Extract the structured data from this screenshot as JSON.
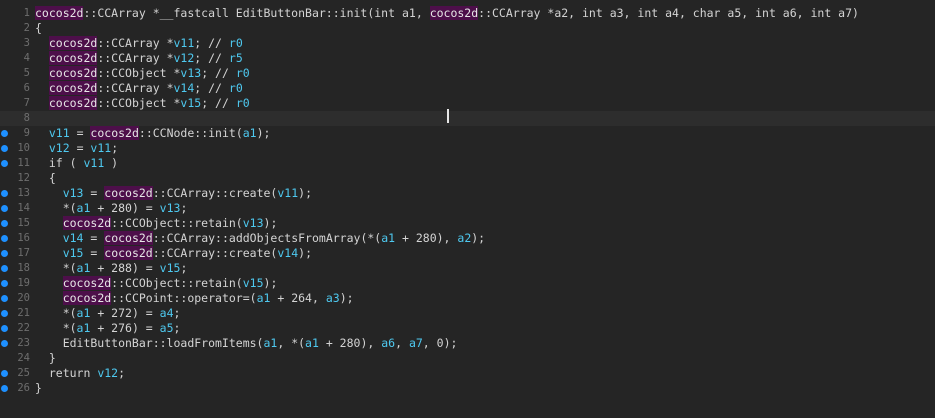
{
  "editor": {
    "lines": [
      {
        "num": "1",
        "dot": false,
        "tokens": [
          {
            "t": "cocos2d",
            "c": "ns"
          },
          {
            "t": "::CCArray *__fastcall EditButtonBar::init(int ",
            "c": "tp"
          },
          {
            "t": "a1",
            "c": "tp"
          },
          {
            "t": ", ",
            "c": "tp"
          },
          {
            "t": "cocos2d",
            "c": "ns"
          },
          {
            "t": "::CCArray *a2, int a3, int a4, char a5, int a6, int a7)",
            "c": "tp"
          }
        ]
      },
      {
        "num": "2",
        "dot": false,
        "tokens": [
          {
            "t": "{",
            "c": "tp"
          }
        ]
      },
      {
        "num": "3",
        "dot": false,
        "tokens": [
          {
            "t": "  ",
            "c": "tp"
          },
          {
            "t": "cocos2d",
            "c": "ns"
          },
          {
            "t": "::CCArray *",
            "c": "tp"
          },
          {
            "t": "v11",
            "c": "var"
          },
          {
            "t": "; // ",
            "c": "cm"
          },
          {
            "t": "r0",
            "c": "var"
          }
        ]
      },
      {
        "num": "4",
        "dot": false,
        "tokens": [
          {
            "t": "  ",
            "c": "tp"
          },
          {
            "t": "cocos2d",
            "c": "ns"
          },
          {
            "t": "::CCArray *",
            "c": "tp"
          },
          {
            "t": "v12",
            "c": "var"
          },
          {
            "t": "; // ",
            "c": "cm"
          },
          {
            "t": "r5",
            "c": "var"
          }
        ]
      },
      {
        "num": "5",
        "dot": false,
        "tokens": [
          {
            "t": "  ",
            "c": "tp"
          },
          {
            "t": "cocos2d",
            "c": "ns"
          },
          {
            "t": "::CCObject *",
            "c": "tp"
          },
          {
            "t": "v13",
            "c": "var"
          },
          {
            "t": "; // ",
            "c": "cm"
          },
          {
            "t": "r0",
            "c": "var"
          }
        ]
      },
      {
        "num": "6",
        "dot": false,
        "tokens": [
          {
            "t": "  ",
            "c": "tp"
          },
          {
            "t": "cocos2d",
            "c": "ns"
          },
          {
            "t": "::CCArray *",
            "c": "tp"
          },
          {
            "t": "v14",
            "c": "var"
          },
          {
            "t": "; // ",
            "c": "cm"
          },
          {
            "t": "r0",
            "c": "var"
          }
        ]
      },
      {
        "num": "7",
        "dot": false,
        "tokens": [
          {
            "t": "  ",
            "c": "tp"
          },
          {
            "t": "cocos2d",
            "c": "ns"
          },
          {
            "t": "::CCObject *",
            "c": "tp"
          },
          {
            "t": "v15",
            "c": "var"
          },
          {
            "t": "; // ",
            "c": "cm"
          },
          {
            "t": "r0",
            "c": "var"
          }
        ]
      },
      {
        "num": "8",
        "dot": false,
        "current": true,
        "tokens": []
      },
      {
        "num": "9",
        "dot": true,
        "tokens": [
          {
            "t": "  ",
            "c": "tp"
          },
          {
            "t": "v11",
            "c": "var"
          },
          {
            "t": " = ",
            "c": "tp"
          },
          {
            "t": "cocos2d",
            "c": "ns"
          },
          {
            "t": "::CCNode::init(",
            "c": "tp"
          },
          {
            "t": "a1",
            "c": "var"
          },
          {
            "t": ");",
            "c": "tp"
          }
        ]
      },
      {
        "num": "10",
        "dot": true,
        "tokens": [
          {
            "t": "  ",
            "c": "tp"
          },
          {
            "t": "v12",
            "c": "var"
          },
          {
            "t": " = ",
            "c": "tp"
          },
          {
            "t": "v11",
            "c": "var"
          },
          {
            "t": ";",
            "c": "tp"
          }
        ]
      },
      {
        "num": "11",
        "dot": true,
        "tokens": [
          {
            "t": "  if ( ",
            "c": "kw"
          },
          {
            "t": "v11",
            "c": "var"
          },
          {
            "t": " )",
            "c": "tp"
          }
        ]
      },
      {
        "num": "12",
        "dot": false,
        "tokens": [
          {
            "t": "  {",
            "c": "tp"
          }
        ]
      },
      {
        "num": "13",
        "dot": true,
        "tokens": [
          {
            "t": "    ",
            "c": "tp"
          },
          {
            "t": "v13",
            "c": "var"
          },
          {
            "t": " = ",
            "c": "tp"
          },
          {
            "t": "cocos2d",
            "c": "ns"
          },
          {
            "t": "::CCArray::create(",
            "c": "tp"
          },
          {
            "t": "v11",
            "c": "var"
          },
          {
            "t": ");",
            "c": "tp"
          }
        ]
      },
      {
        "num": "14",
        "dot": true,
        "tokens": [
          {
            "t": "    *(",
            "c": "tp"
          },
          {
            "t": "a1",
            "c": "var"
          },
          {
            "t": " + 280) = ",
            "c": "tp"
          },
          {
            "t": "v13",
            "c": "var"
          },
          {
            "t": ";",
            "c": "tp"
          }
        ]
      },
      {
        "num": "15",
        "dot": true,
        "tokens": [
          {
            "t": "    ",
            "c": "tp"
          },
          {
            "t": "cocos2d",
            "c": "ns"
          },
          {
            "t": "::CCObject::retain(",
            "c": "tp"
          },
          {
            "t": "v13",
            "c": "var"
          },
          {
            "t": ");",
            "c": "tp"
          }
        ]
      },
      {
        "num": "16",
        "dot": true,
        "tokens": [
          {
            "t": "    ",
            "c": "tp"
          },
          {
            "t": "v14",
            "c": "var"
          },
          {
            "t": " = ",
            "c": "tp"
          },
          {
            "t": "cocos2d",
            "c": "ns"
          },
          {
            "t": "::CCArray::addObjectsFromArray(*(",
            "c": "tp"
          },
          {
            "t": "a1",
            "c": "var"
          },
          {
            "t": " + 280), ",
            "c": "tp"
          },
          {
            "t": "a2",
            "c": "var"
          },
          {
            "t": ");",
            "c": "tp"
          }
        ]
      },
      {
        "num": "17",
        "dot": true,
        "tokens": [
          {
            "t": "    ",
            "c": "tp"
          },
          {
            "t": "v15",
            "c": "var"
          },
          {
            "t": " = ",
            "c": "tp"
          },
          {
            "t": "cocos2d",
            "c": "ns"
          },
          {
            "t": "::CCArray::create(",
            "c": "tp"
          },
          {
            "t": "v14",
            "c": "var"
          },
          {
            "t": ");",
            "c": "tp"
          }
        ]
      },
      {
        "num": "18",
        "dot": true,
        "tokens": [
          {
            "t": "    *(",
            "c": "tp"
          },
          {
            "t": "a1",
            "c": "var"
          },
          {
            "t": " + 288) = ",
            "c": "tp"
          },
          {
            "t": "v15",
            "c": "var"
          },
          {
            "t": ";",
            "c": "tp"
          }
        ]
      },
      {
        "num": "19",
        "dot": true,
        "tokens": [
          {
            "t": "    ",
            "c": "tp"
          },
          {
            "t": "cocos2d",
            "c": "ns"
          },
          {
            "t": "::CCObject::retain(",
            "c": "tp"
          },
          {
            "t": "v15",
            "c": "var"
          },
          {
            "t": ");",
            "c": "tp"
          }
        ]
      },
      {
        "num": "20",
        "dot": true,
        "tokens": [
          {
            "t": "    ",
            "c": "tp"
          },
          {
            "t": "cocos2d",
            "c": "ns"
          },
          {
            "t": "::CCPoint::operator=(",
            "c": "tp"
          },
          {
            "t": "a1",
            "c": "var"
          },
          {
            "t": " + 264, ",
            "c": "tp"
          },
          {
            "t": "a3",
            "c": "var"
          },
          {
            "t": ");",
            "c": "tp"
          }
        ]
      },
      {
        "num": "21",
        "dot": true,
        "tokens": [
          {
            "t": "    *(",
            "c": "tp"
          },
          {
            "t": "a1",
            "c": "var"
          },
          {
            "t": " + 272) = ",
            "c": "tp"
          },
          {
            "t": "a4",
            "c": "var"
          },
          {
            "t": ";",
            "c": "tp"
          }
        ]
      },
      {
        "num": "22",
        "dot": true,
        "tokens": [
          {
            "t": "    *(",
            "c": "tp"
          },
          {
            "t": "a1",
            "c": "var"
          },
          {
            "t": " + 276) = ",
            "c": "tp"
          },
          {
            "t": "a5",
            "c": "var"
          },
          {
            "t": ";",
            "c": "tp"
          }
        ]
      },
      {
        "num": "23",
        "dot": true,
        "tokens": [
          {
            "t": "    EditButtonBar::loadFromItems(",
            "c": "tp"
          },
          {
            "t": "a1",
            "c": "var"
          },
          {
            "t": ", *(",
            "c": "tp"
          },
          {
            "t": "a1",
            "c": "var"
          },
          {
            "t": " + 280), ",
            "c": "tp"
          },
          {
            "t": "a6",
            "c": "var"
          },
          {
            "t": ", ",
            "c": "tp"
          },
          {
            "t": "a7",
            "c": "var"
          },
          {
            "t": ", 0);",
            "c": "tp"
          }
        ]
      },
      {
        "num": "24",
        "dot": false,
        "tokens": [
          {
            "t": "  }",
            "c": "tp"
          }
        ]
      },
      {
        "num": "25",
        "dot": true,
        "tokens": [
          {
            "t": "  return ",
            "c": "kw"
          },
          {
            "t": "v12",
            "c": "var"
          },
          {
            "t": ";",
            "c": "tp"
          }
        ]
      },
      {
        "num": "26",
        "dot": true,
        "tokens": [
          {
            "t": "}",
            "c": "tp"
          }
        ]
      }
    ]
  },
  "colors": {
    "background": "#252525",
    "namespace_highlight": "#4d0f4a",
    "variable": "#4ec9f0",
    "breakpoint_dot": "#1e90ff",
    "line_number": "#6e6e6e"
  }
}
